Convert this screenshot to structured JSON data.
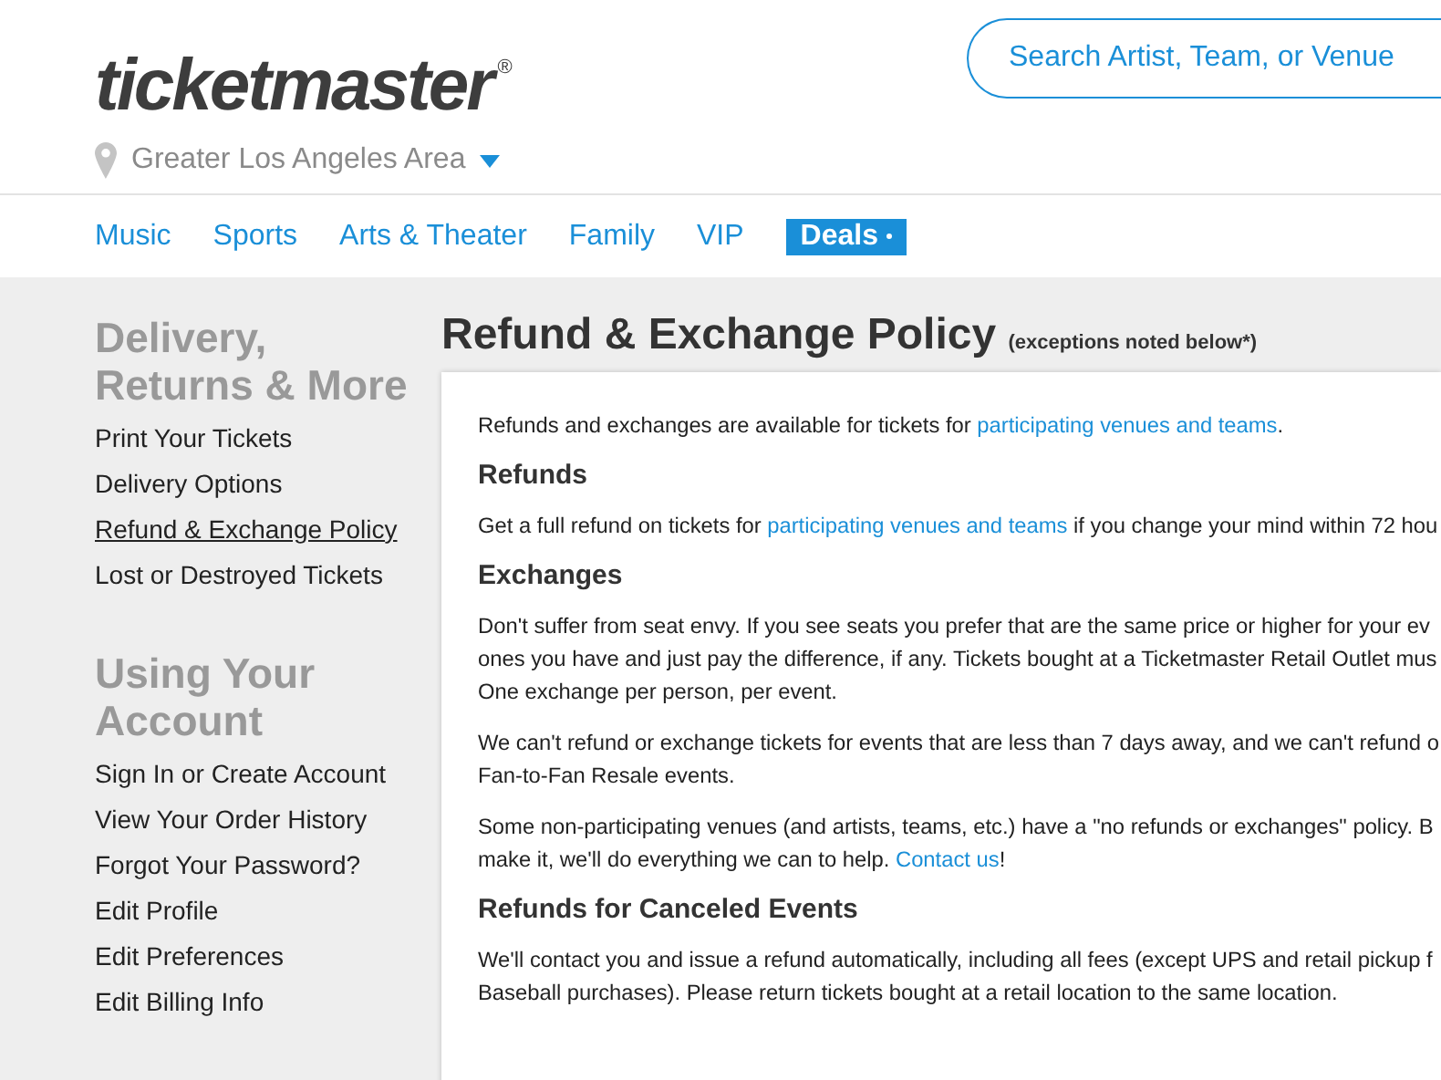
{
  "logo": {
    "text": "ticketmaster",
    "mark": "®"
  },
  "search": {
    "placeholder": "Search Artist, Team, or Venue"
  },
  "location": {
    "label": "Greater Los Angeles Area"
  },
  "nav": [
    {
      "label": "Music",
      "kind": "link"
    },
    {
      "label": "Sports",
      "kind": "link"
    },
    {
      "label": "Arts & Theater",
      "kind": "link"
    },
    {
      "label": "Family",
      "kind": "link"
    },
    {
      "label": "VIP",
      "kind": "link"
    },
    {
      "label": "Deals",
      "kind": "badge"
    }
  ],
  "sidebar": [
    {
      "heading": "Delivery, Returns & More",
      "items": [
        {
          "label": "Print Your Tickets",
          "selected": false
        },
        {
          "label": "Delivery Options",
          "selected": false
        },
        {
          "label": "Refund & Exchange Policy",
          "selected": true
        },
        {
          "label": "Lost or Destroyed Tickets",
          "selected": false
        }
      ]
    },
    {
      "heading": "Using Your Account",
      "items": [
        {
          "label": "Sign In or Create Account",
          "selected": false
        },
        {
          "label": "View Your Order History",
          "selected": false
        },
        {
          "label": "Forgot Your Password?",
          "selected": false
        },
        {
          "label": "Edit Profile",
          "selected": false
        },
        {
          "label": "Edit Preferences",
          "selected": false
        },
        {
          "label": "Edit Billing Info",
          "selected": false
        }
      ]
    }
  ],
  "page": {
    "title": "Refund & Exchange Policy",
    "note": "(exceptions noted below*)"
  },
  "content": [
    {
      "kind": "paragraph",
      "lines": [
        [
          {
            "kind": "plain",
            "text": "Refunds and exchanges are available for tickets for "
          },
          {
            "kind": "link",
            "text": "participating venues and teams"
          },
          {
            "kind": "plain",
            "text": "."
          }
        ]
      ]
    },
    {
      "kind": "heading",
      "text": "Refunds"
    },
    {
      "kind": "paragraph",
      "lines": [
        [
          {
            "kind": "plain",
            "text": "Get a full refund on tickets for "
          },
          {
            "kind": "link",
            "text": "participating venues and teams"
          },
          {
            "kind": "plain",
            "text": " if you change your mind within 72 hou"
          }
        ]
      ]
    },
    {
      "kind": "heading",
      "text": "Exchanges"
    },
    {
      "kind": "paragraph",
      "lines": [
        [
          {
            "kind": "plain",
            "text": "Don't suffer from seat envy. If you see seats you prefer that are the same price or higher for your ev"
          }
        ],
        [
          {
            "kind": "plain",
            "text": "ones you have and just pay the difference, if any. Tickets bought at a Ticketmaster Retail Outlet mus"
          }
        ],
        [
          {
            "kind": "plain",
            "text": "One exchange per person, per event."
          }
        ]
      ]
    },
    {
      "kind": "paragraph",
      "lines": [
        [
          {
            "kind": "plain",
            "text": "We can't refund or exchange tickets for events that are less than 7 days away, and we can't refund o"
          }
        ],
        [
          {
            "kind": "plain",
            "text": "Fan-to-Fan Resale events."
          }
        ]
      ]
    },
    {
      "kind": "paragraph",
      "lines": [
        [
          {
            "kind": "plain",
            "text": "Some non-participating venues (and artists, teams, etc.) have a \"no refunds or exchanges\" policy. B"
          }
        ],
        [
          {
            "kind": "plain",
            "text": "make it, we'll do everything we can to help. "
          },
          {
            "kind": "link",
            "text": "Contact us"
          },
          {
            "kind": "plain",
            "text": "!"
          }
        ]
      ]
    },
    {
      "kind": "heading",
      "text": "Refunds for Canceled Events"
    },
    {
      "kind": "paragraph",
      "lines": [
        [
          {
            "kind": "plain",
            "text": "We'll contact you and issue a refund automatically, including all fees (except UPS and retail pickup f"
          }
        ],
        [
          {
            "kind": "plain",
            "text": "Baseball purchases). Please return tickets bought at a retail location to the same location."
          }
        ]
      ]
    }
  ]
}
